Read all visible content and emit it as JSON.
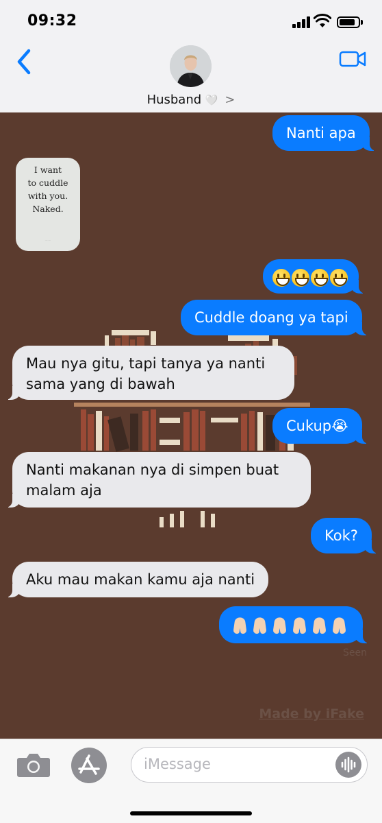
{
  "status_bar": {
    "time": "09:32"
  },
  "header": {
    "contact_name": "Husband",
    "contact_heart": "🤍",
    "contact_chevron": ">"
  },
  "image_message": {
    "lines": [
      "I want",
      "to cuddle",
      "with you.",
      "Naked."
    ]
  },
  "messages": [
    {
      "side": "out",
      "text": "Nanti apa"
    },
    {
      "side": "out",
      "text": "😃😃😃😃"
    },
    {
      "side": "out",
      "text": "Cuddle doang ya tapi"
    },
    {
      "side": "in",
      "text": "Mau nya gitu, tapi tanya ya nanti sama yang di bawah"
    },
    {
      "side": "out",
      "text": "Cukup😭"
    },
    {
      "side": "in",
      "text": "Nanti makanan nya di simpen buat malam aja"
    },
    {
      "side": "out",
      "text": "Kok?"
    },
    {
      "side": "in",
      "text": "Aku mau makan kamu aja nanti"
    },
    {
      "side": "out",
      "text": "🙏🏻🙏🏻🙏🏻🙏🏻🙏🏻🙏🏻"
    }
  ],
  "read_receipt": "Seen",
  "watermark": "Made by iFake",
  "input_bar": {
    "placeholder": "iMessage"
  },
  "colors": {
    "outgoing_bubble": "#0a7cff",
    "incoming_bubble": "#e9e9ec",
    "chat_background": "#5b3b2e",
    "accent": "#0a7cff"
  },
  "icons": [
    "back-chevron-icon",
    "video-camera-icon",
    "camera-icon",
    "app-store-icon",
    "audio-waveform-icon",
    "signal-icon",
    "wifi-icon",
    "battery-icon"
  ]
}
